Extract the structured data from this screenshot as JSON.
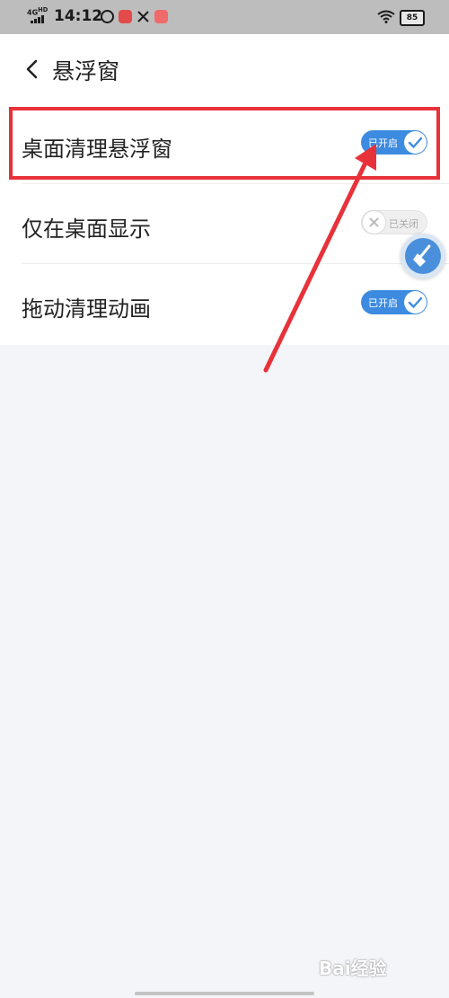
{
  "status_bar": {
    "network": "4G",
    "network_sup": "HD",
    "time": "14:12",
    "battery": "85"
  },
  "header": {
    "title": "悬浮窗"
  },
  "settings": [
    {
      "label": "桌面清理悬浮窗",
      "state": "已开启",
      "enabled": true
    },
    {
      "label": "仅在桌面显示",
      "state": "已关闭",
      "enabled": false
    },
    {
      "label": "拖动清理动画",
      "state": "已开启",
      "enabled": true
    }
  ],
  "watermark": "Bai经验",
  "colors": {
    "toggle_on": "#3d8be0",
    "highlight": "#e8323a",
    "background": "#f4f5f9"
  }
}
